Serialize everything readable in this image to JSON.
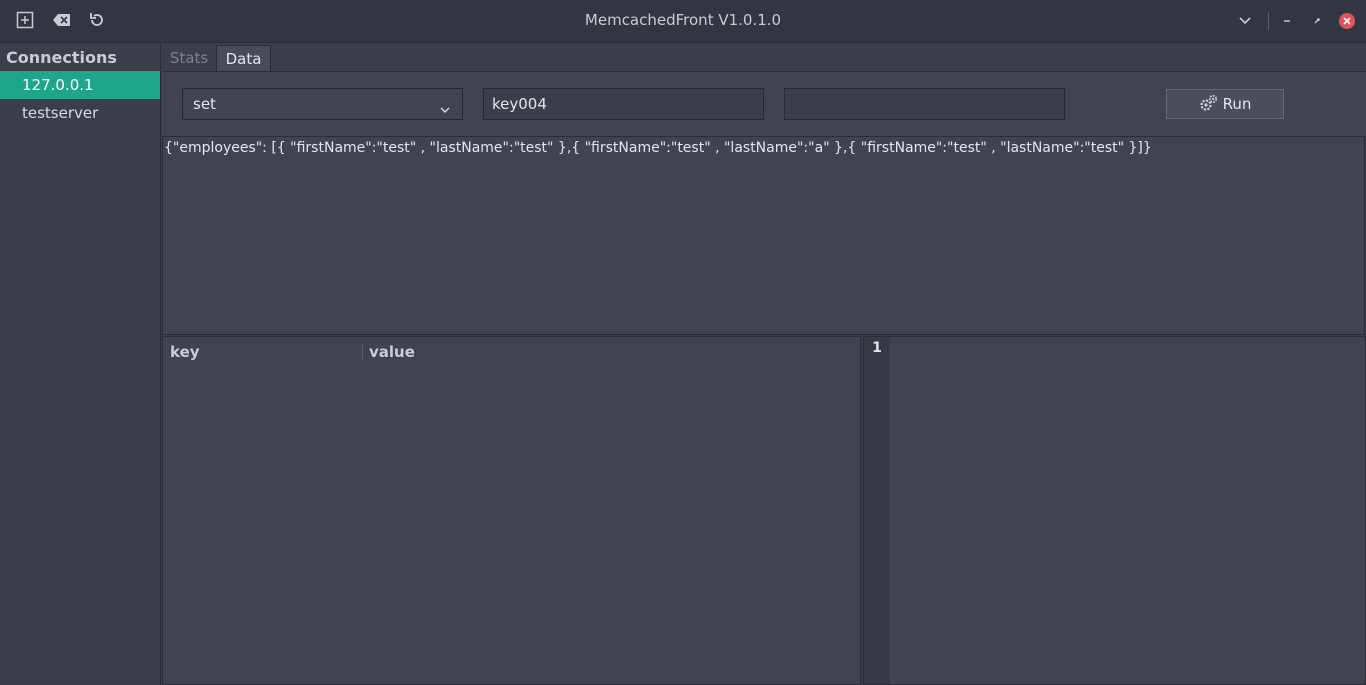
{
  "window": {
    "title": "MemcachedFront V1.0.1.0",
    "toolbar_icons": [
      "add-icon",
      "clear-icon",
      "refresh-icon"
    ],
    "controls": [
      "chevron-down-icon",
      "minimize-icon",
      "maximize-icon",
      "close-icon"
    ]
  },
  "sidebar": {
    "header": "Connections",
    "items": [
      {
        "label": "127.0.0.1",
        "active": true
      },
      {
        "label": "testserver",
        "active": false
      }
    ]
  },
  "tabs": [
    {
      "label": "Stats",
      "active": false
    },
    {
      "label": "Data",
      "active": true
    }
  ],
  "command": {
    "operation": "set",
    "key": "key004",
    "extra": "",
    "run_label": "Run"
  },
  "editor": {
    "text": "{\"employees\": [{ \"firstName\":\"test\" , \"lastName\":\"test\" },{ \"firstName\":\"test\" , \"lastName\":\"a\" },{ \"firstName\":\"test\" , \"lastName\":\"test\" }]}"
  },
  "results_table": {
    "columns": [
      "key",
      "value"
    ],
    "rows": []
  },
  "code_view": {
    "line_numbers": [
      "1"
    ]
  },
  "colors": {
    "accent": "#1fa58a",
    "close": "#e0525b",
    "background": "#3b3f4a"
  }
}
